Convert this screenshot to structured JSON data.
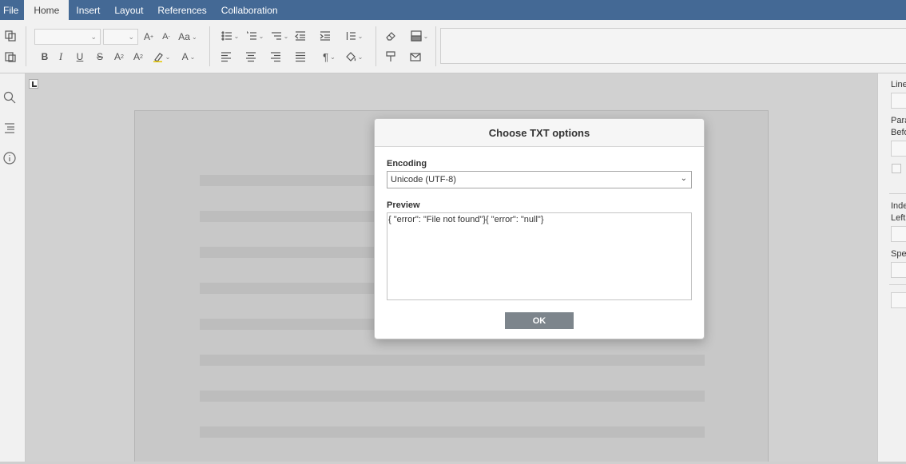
{
  "menu": {
    "tabs": [
      {
        "label": "File"
      },
      {
        "label": "Home"
      },
      {
        "label": "Insert"
      },
      {
        "label": "Layout"
      },
      {
        "label": "References"
      },
      {
        "label": "Collaboration"
      }
    ],
    "active": "Home"
  },
  "toolbar": {
    "icons": [
      "copy-icon",
      "paste-icon",
      "font-family-combo",
      "font-size-combo",
      "increase-font-icon",
      "decrease-font-icon",
      "change-case-icon",
      "bullets-icon",
      "numbering-icon",
      "multilevel-icon",
      "decrease-indent-icon",
      "increase-indent-icon",
      "line-spacing-icon",
      "clear-style-icon",
      "shading-icon",
      "bold-icon",
      "italic-icon",
      "underline-icon",
      "strikethrough-icon",
      "superscript-icon",
      "subscript-icon",
      "highlight-icon",
      "font-color-icon",
      "align-left-icon",
      "align-center-icon",
      "align-right-icon",
      "justify-icon",
      "nonprinting-icon",
      "fill-icon",
      "copy-style-icon",
      "mail-merge-icon"
    ]
  },
  "leftbar": {
    "icons": [
      "search-icon",
      "navigation-icon",
      "info-icon"
    ]
  },
  "rightpanel": {
    "labels": [
      "Line",
      "Para",
      "Befo",
      "Inde",
      "Left",
      "Spe"
    ]
  },
  "dialog": {
    "title": "Choose TXT options",
    "encoding_label": "Encoding",
    "encoding_value": "Unicode (UTF-8)",
    "preview_label": "Preview",
    "preview_text": "{ \"error\": \"File not found\"}{ \"error\": \"null\"}",
    "ok_label": "OK"
  },
  "colors": {
    "menubar": "#446995",
    "ok_button": "#7d858c"
  }
}
